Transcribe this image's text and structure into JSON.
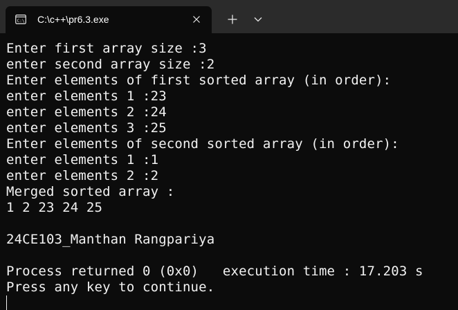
{
  "tab": {
    "title": "C:\\c++\\pr6.3.exe",
    "icon": "console-icon",
    "close_icon": "close-icon"
  },
  "toolbar": {
    "new_tab_icon": "plus-icon",
    "dropdown_icon": "chevron-down-icon"
  },
  "colors": {
    "background": "#0c0c0c",
    "tabbar": "#2b2b2b",
    "text": "#f2f2f2"
  },
  "terminal": {
    "lines": [
      "Enter first array size :3",
      "enter second array size :2",
      "Enter elements of first sorted array (in order):",
      "enter elements 1 :23",
      "enter elements 2 :24",
      "enter elements 3 :25",
      "Enter elements of second sorted array (in order):",
      "enter elements 1 :1",
      "enter elements 2 :2",
      "Merged sorted array :",
      "1 2 23 24 25",
      "",
      "24CE103_Manthan Rangpariya",
      "",
      "Process returned 0 (0x0)   execution time : 17.203 s",
      "Press any key to continue."
    ]
  }
}
